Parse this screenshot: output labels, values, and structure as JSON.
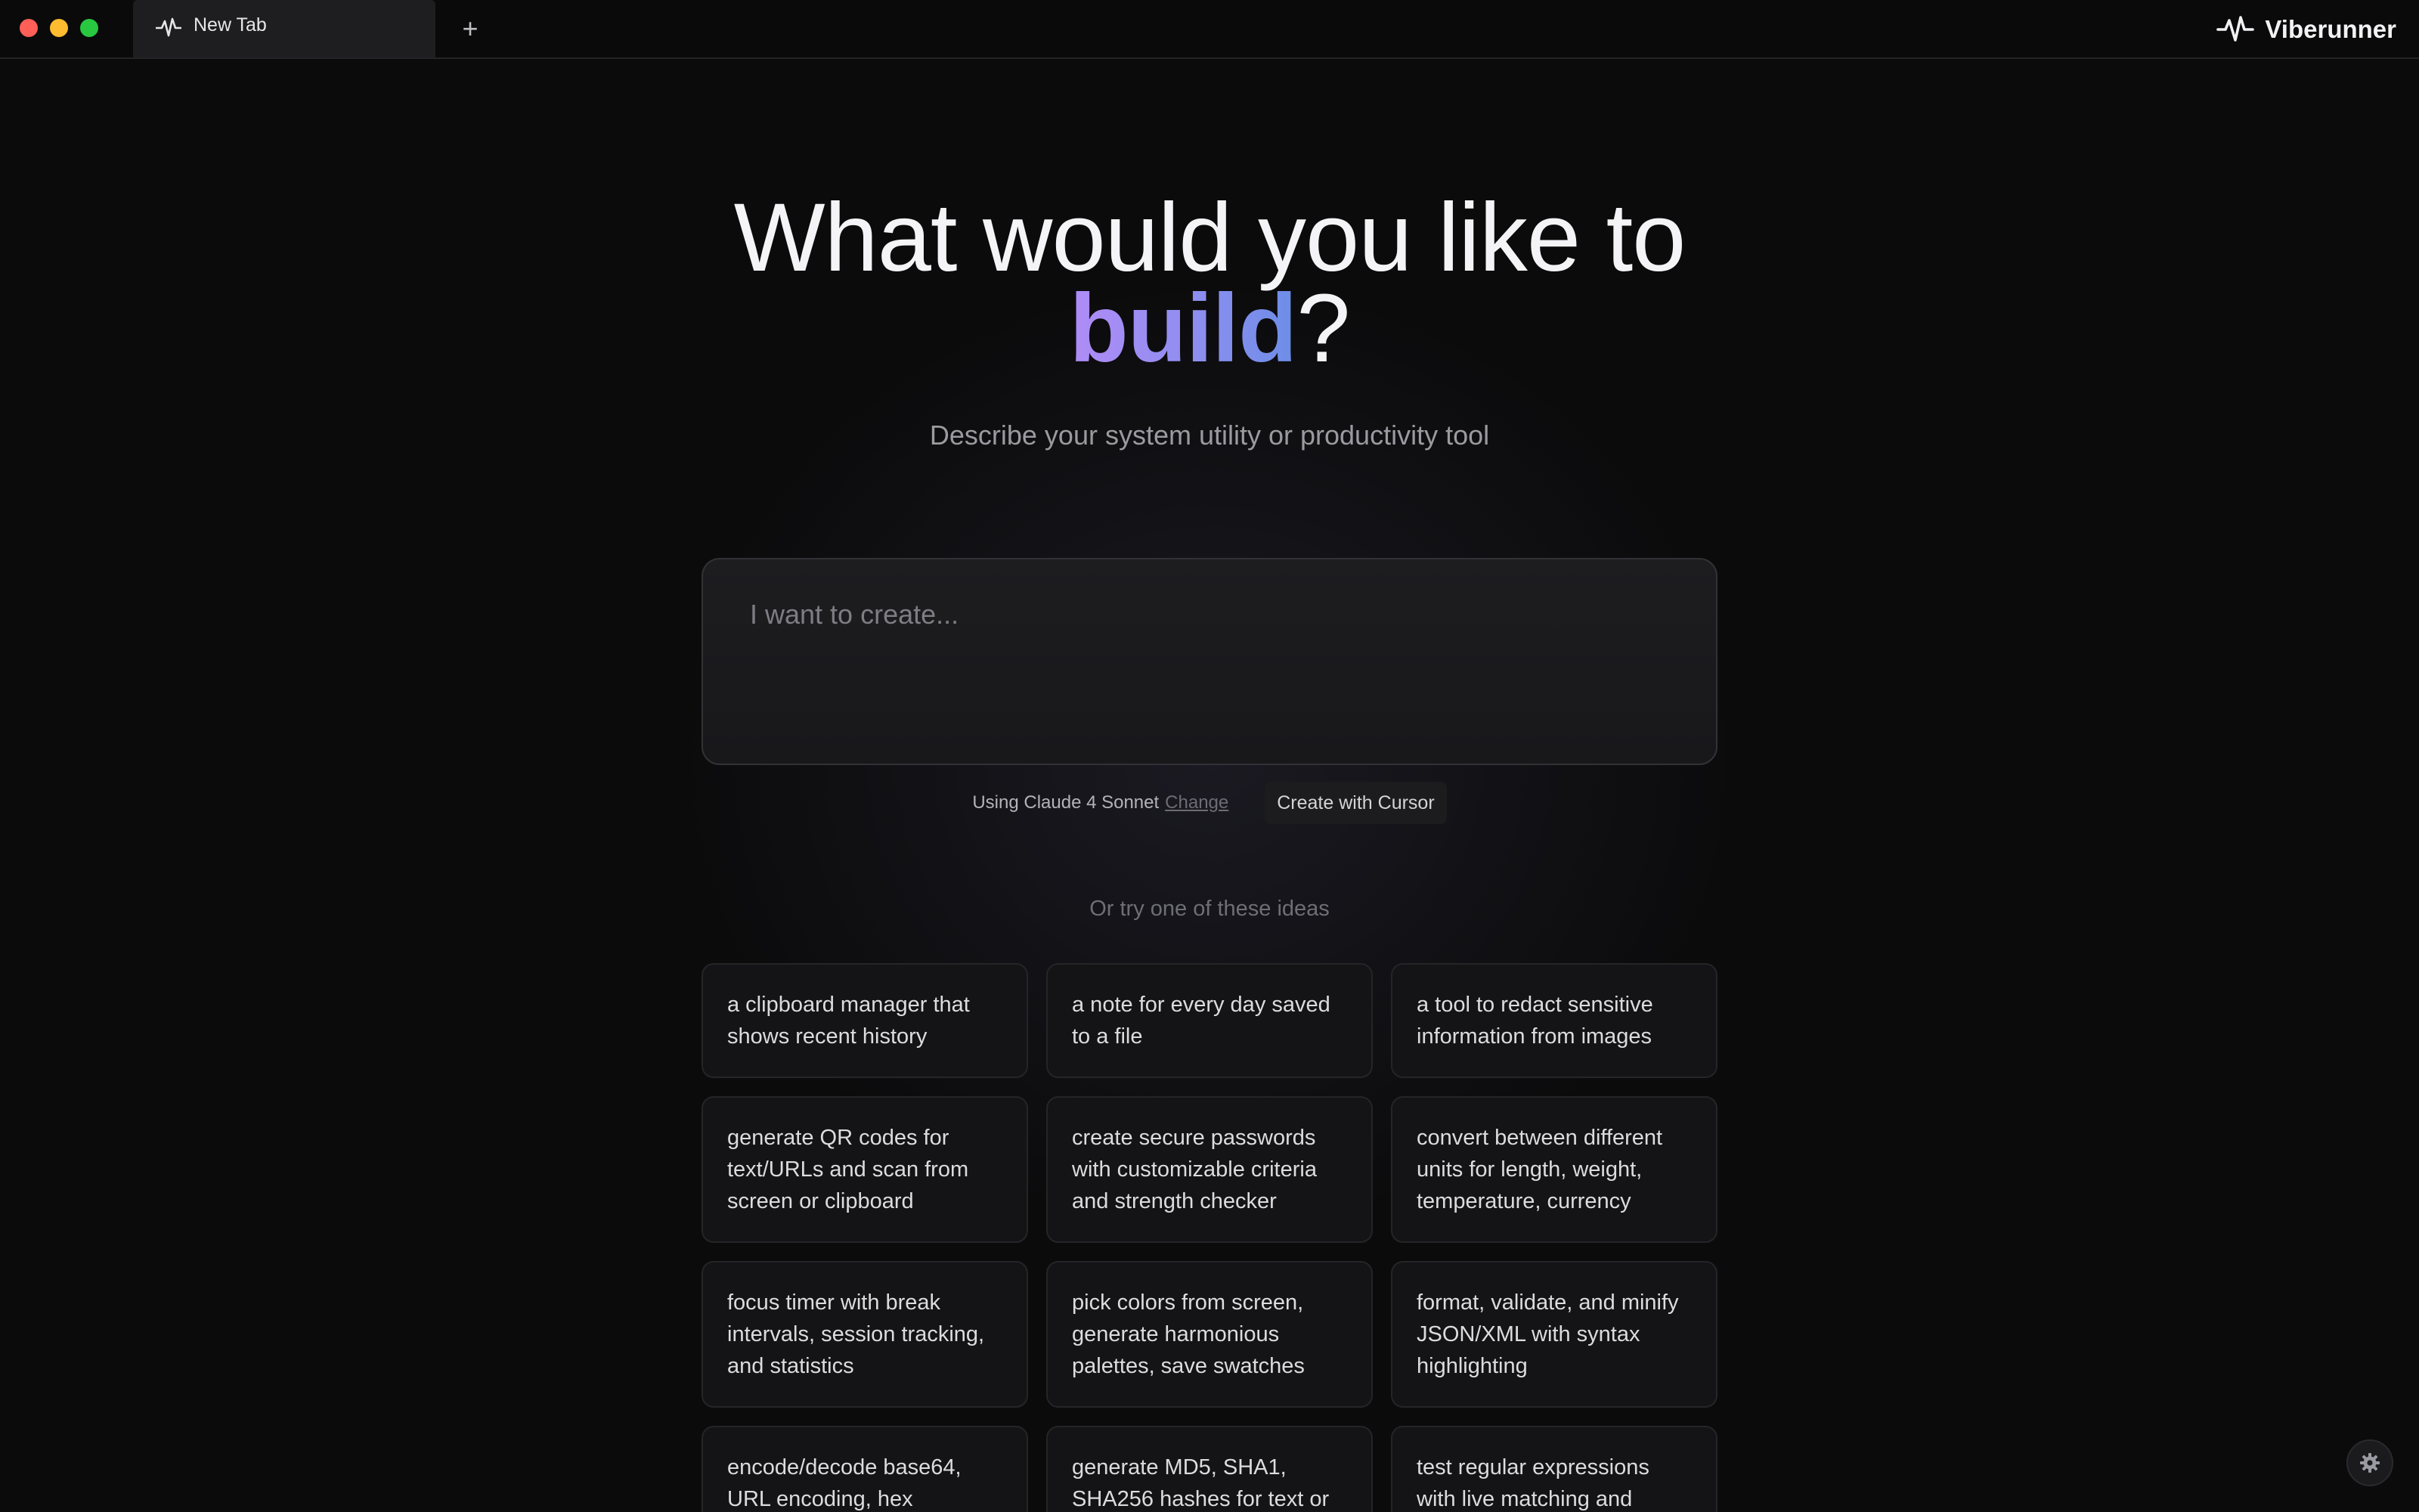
{
  "window": {
    "traffic_lights": {
      "close": "#ff5f57",
      "minimize": "#febc2e",
      "zoom": "#28c840"
    }
  },
  "tabs": [
    {
      "title": "New Tab",
      "icon": "activity-pulse-icon",
      "active": true
    }
  ],
  "new_tab": {
    "label": "+"
  },
  "brand": {
    "name": "Viberunner",
    "icon": "activity-pulse-icon"
  },
  "hero": {
    "title_prefix": "What would you like to",
    "title_accent": "build",
    "title_suffix": "?",
    "subtitle": "Describe your system utility or productivity tool",
    "accent_gradient": [
      "#b08cf6",
      "#6c8ee6"
    ]
  },
  "prompt": {
    "placeholder": "I want to create...",
    "value": ""
  },
  "model": {
    "label": "Using Claude 4 Sonnet",
    "change_label": "Change",
    "create_button": "Create with Cursor"
  },
  "ideas": {
    "heading": "Or try one of these ideas",
    "items": [
      "a clipboard manager that shows recent history",
      "a note for every day saved to a file",
      "a tool to redact sensitive information from images",
      "generate QR codes for text/URLs and scan from screen or clipboard",
      "create secure passwords with customizable criteria and strength checker",
      "convert between different units for length, weight, temperature, currency",
      "focus timer with break intervals, session tracking, and statistics",
      "pick colors from screen, generate harmonious palettes, save swatches",
      "format, validate, and minify JSON/XML with syntax highlighting",
      "encode/decode base64, URL encoding, hex",
      "generate MD5, SHA1, SHA256 hashes for text or",
      "test regular expressions with live matching and"
    ]
  },
  "settings": {
    "icon": "gear-icon"
  }
}
